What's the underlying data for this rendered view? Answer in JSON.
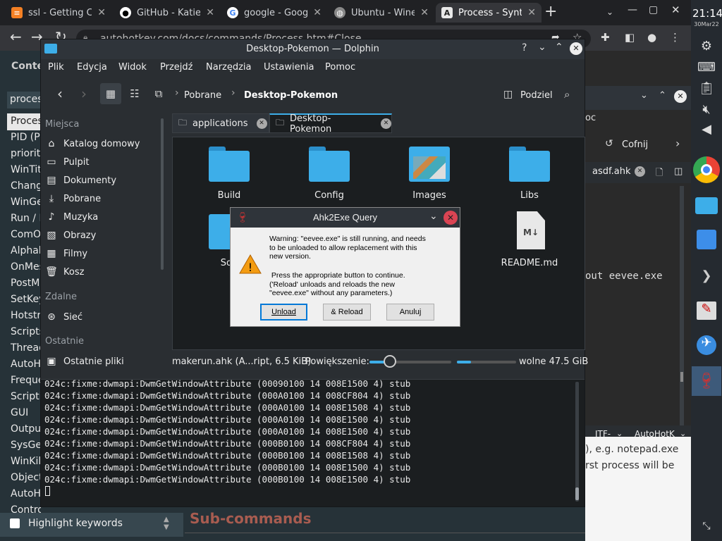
{
  "browser": {
    "tabs": [
      {
        "label": "ssl - Getting Cl",
        "icon": "stackoverflow-icon"
      },
      {
        "label": "GitHub - Katie",
        "icon": "github-icon"
      },
      {
        "label": "google - Goog",
        "icon": "google-icon"
      },
      {
        "label": "Ubuntu - Wine",
        "icon": "globe-icon"
      },
      {
        "label": "Process - Synt",
        "icon": "autohotkey-icon"
      }
    ],
    "new_tab": "+",
    "address": "autohotkey.com/docs/commands/Process.htm#Close",
    "clock": "21:14",
    "date": "30Mar22"
  },
  "webpage": {
    "header": "Conte",
    "search_value": "proces",
    "toc": [
      "Proces",
      "PID (P",
      "priority",
      "WinTitl",
      "Chang",
      "WinGe",
      "Run / R",
      "ComO",
      "Alphab",
      "OnMes",
      "PostMe",
      "SetKey",
      "Hotstri",
      "Scripts",
      "Thread",
      "AutoHo",
      "Freque",
      "Scriptin",
      "GUI",
      "Output",
      "SysGe",
      "WinKil",
      "Object",
      "AutoHo",
      "ControlGet"
    ],
    "highlight_label": "Highlight keywords",
    "subheading": "Sub-commands",
    "right_tab": "asdf.ahk",
    "undo_label": "Cofnij",
    "code_snippet": "out eevee.exe",
    "oc_fragment": "oc",
    "status_enc": "ITF-",
    "status_lang": "AutoHotK",
    "para1": "), e.g. notepad.exe",
    "para2": "rst process will be"
  },
  "dolphin": {
    "title": "Desktop-Pokemon — Dolphin",
    "menu": [
      "Plik",
      "Edycja",
      "Widok",
      "Przejdź",
      "Narzędzia",
      "Ustawienia",
      "Pomoc"
    ],
    "breadcrumb": [
      "Pobrane",
      "Desktop-Pokemon"
    ],
    "split_label": "Podziel",
    "places_header": "Miejsca",
    "places": [
      "Katalog domowy",
      "Pulpit",
      "Dokumenty",
      "Pobrane",
      "Muzyka",
      "Obrazy",
      "Filmy",
      "Kosz"
    ],
    "remote_header": "Zdalne",
    "remote": [
      "Sieć"
    ],
    "recent_header": "Ostatnie",
    "recent": [
      "Ostatnie pliki"
    ],
    "tabs": [
      "applications",
      "Desktop-Pokemon"
    ],
    "files": [
      "Build",
      "Config",
      "Images",
      "Libs",
      "Sou",
      "README.md"
    ],
    "status_file": "makerun.ahk (A...ript, 6.5 KiB)",
    "zoom_label": "Powiększenie:",
    "zoom_value": 0.25,
    "free_space": "wolne 47.5 GiB",
    "console": [
      "024c:fixme:dwmapi:DwmGetWindowAttribute (00090100 14 008E1500 4) stub",
      "024c:fixme:dwmapi:DwmGetWindowAttribute (000A0100 14 008CF804 4) stub",
      "024c:fixme:dwmapi:DwmGetWindowAttribute (000A0100 14 008E1508 4) stub",
      "024c:fixme:dwmapi:DwmGetWindowAttribute (000A0100 14 008E1500 4) stub",
      "024c:fixme:dwmapi:DwmGetWindowAttribute (000A0100 14 008E1500 4) stub",
      "024c:fixme:dwmapi:DwmGetWindowAttribute (000B0100 14 008CF804 4) stub",
      "024c:fixme:dwmapi:DwmGetWindowAttribute (000B0100 14 008E1508 4) stub",
      "024c:fixme:dwmapi:DwmGetWindowAttribute (000B0100 14 008E1500 4) stub",
      "024c:fixme:dwmapi:DwmGetWindowAttribute (000B0100 14 008E1500 4) stub"
    ]
  },
  "dialog": {
    "title": "Ahk2Exe Query",
    "message1": "Warning: \"eevee.exe\" is still running, and needs\nto be unloaded to allow replacement with this\nnew version.",
    "message2": " Press the appropriate button to continue.\n('Reload' unloads and reloads the new\n\"eevee.exe\" without any parameters.)",
    "buttons": [
      "Unload",
      "& Reload",
      "Anuluj"
    ]
  },
  "colors": {
    "accent": "#3daee9",
    "folder": "#3daee9",
    "close": "#da4453"
  }
}
